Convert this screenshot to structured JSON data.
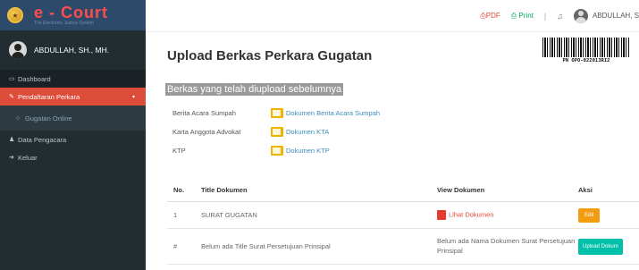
{
  "app": {
    "logo_text": "e - Court",
    "logo_subtitle": "The Electronic Justice System",
    "user_name": "ABDULLAH, SH., MH."
  },
  "sidebar": {
    "items": [
      {
        "label": "Dashboard",
        "icon": "dashboard-icon"
      },
      {
        "label": "Pendaftaran Perkara",
        "icon": "edit-icon",
        "active": true
      },
      {
        "label": "Gugatan Online",
        "icon": "circle-icon"
      },
      {
        "label": "Data Pengacara",
        "icon": "user-icon"
      },
      {
        "label": "Keluar",
        "icon": "sign-out-icon"
      }
    ]
  },
  "topbar": {
    "pdf_label": "PDF",
    "print_label": "Print",
    "separator": "|",
    "user_name": "ABDULLAH, S"
  },
  "page": {
    "title": "Upload Berkas Perkara Gugatan",
    "barcode_text": "PN OPO-022013RI2"
  },
  "uploaded": {
    "heading": "Berkas yang telah diupload sebelumnya",
    "files": [
      {
        "label": "Berita Acara Sumpah",
        "link": "Dokumen Berita Acara Sumpah"
      },
      {
        "label": "Karta Anggota Advokat",
        "link": "Dokumen KTA"
      },
      {
        "label": "KTP",
        "link": "Dokumen KTP"
      }
    ]
  },
  "table": {
    "headers": {
      "no": "No.",
      "title": "Title Dokumen",
      "view": "View Dokumen",
      "action": "Aksi"
    },
    "rows": [
      {
        "no": "1",
        "title": "SURAT GUGATAN",
        "view": "Lihat Dokumen",
        "action": "Edit"
      },
      {
        "no": "#",
        "title": "Belum ada Title Surat Persetujuan Prinsipal",
        "view": "Belum ada Nama Dokumen Surat Persetujuan Prinsipal",
        "action": "Upload Dokum"
      }
    ]
  },
  "colors": {
    "sidebar_bg": "#222d32",
    "active_menu": "#dd4b39",
    "link": "#3c8dbc",
    "edit_button": "#f39c12",
    "upload_button": "#00c0a8"
  }
}
